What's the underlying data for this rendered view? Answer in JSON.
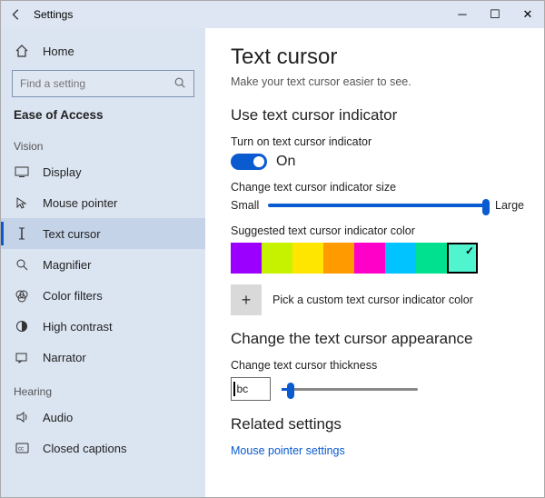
{
  "titlebar": {
    "title": "Settings"
  },
  "sidebar": {
    "home": "Home",
    "search_placeholder": "Find a setting",
    "breadcrumb": "Ease of Access",
    "group_vision": "Vision",
    "items_vision": [
      {
        "label": "Display"
      },
      {
        "label": "Mouse pointer"
      },
      {
        "label": "Text cursor"
      },
      {
        "label": "Magnifier"
      },
      {
        "label": "Color filters"
      },
      {
        "label": "High contrast"
      },
      {
        "label": "Narrator"
      }
    ],
    "group_hearing": "Hearing",
    "items_hearing": [
      {
        "label": "Audio"
      },
      {
        "label": "Closed captions"
      }
    ]
  },
  "main": {
    "h1": "Text cursor",
    "subtitle": "Make your text cursor easier to see.",
    "section_indicator": "Use text cursor indicator",
    "toggle_label": "Turn on text cursor indicator",
    "toggle_state": "On",
    "size_label": "Change text cursor indicator size",
    "size_small": "Small",
    "size_large": "Large",
    "color_label": "Suggested text cursor indicator color",
    "colors": [
      "#9b00ff",
      "#c6f200",
      "#ffe600",
      "#ff9a00",
      "#ff00c8",
      "#00c3ff",
      "#00e18f",
      "#50f5d0"
    ],
    "selected_color_index": 7,
    "custom_label": "Pick a custom text cursor indicator color",
    "section_appearance": "Change the text cursor appearance",
    "thickness_label": "Change text cursor thickness",
    "thickness_sample": "bc",
    "section_related": "Related settings",
    "link_mouse": "Mouse pointer settings"
  }
}
